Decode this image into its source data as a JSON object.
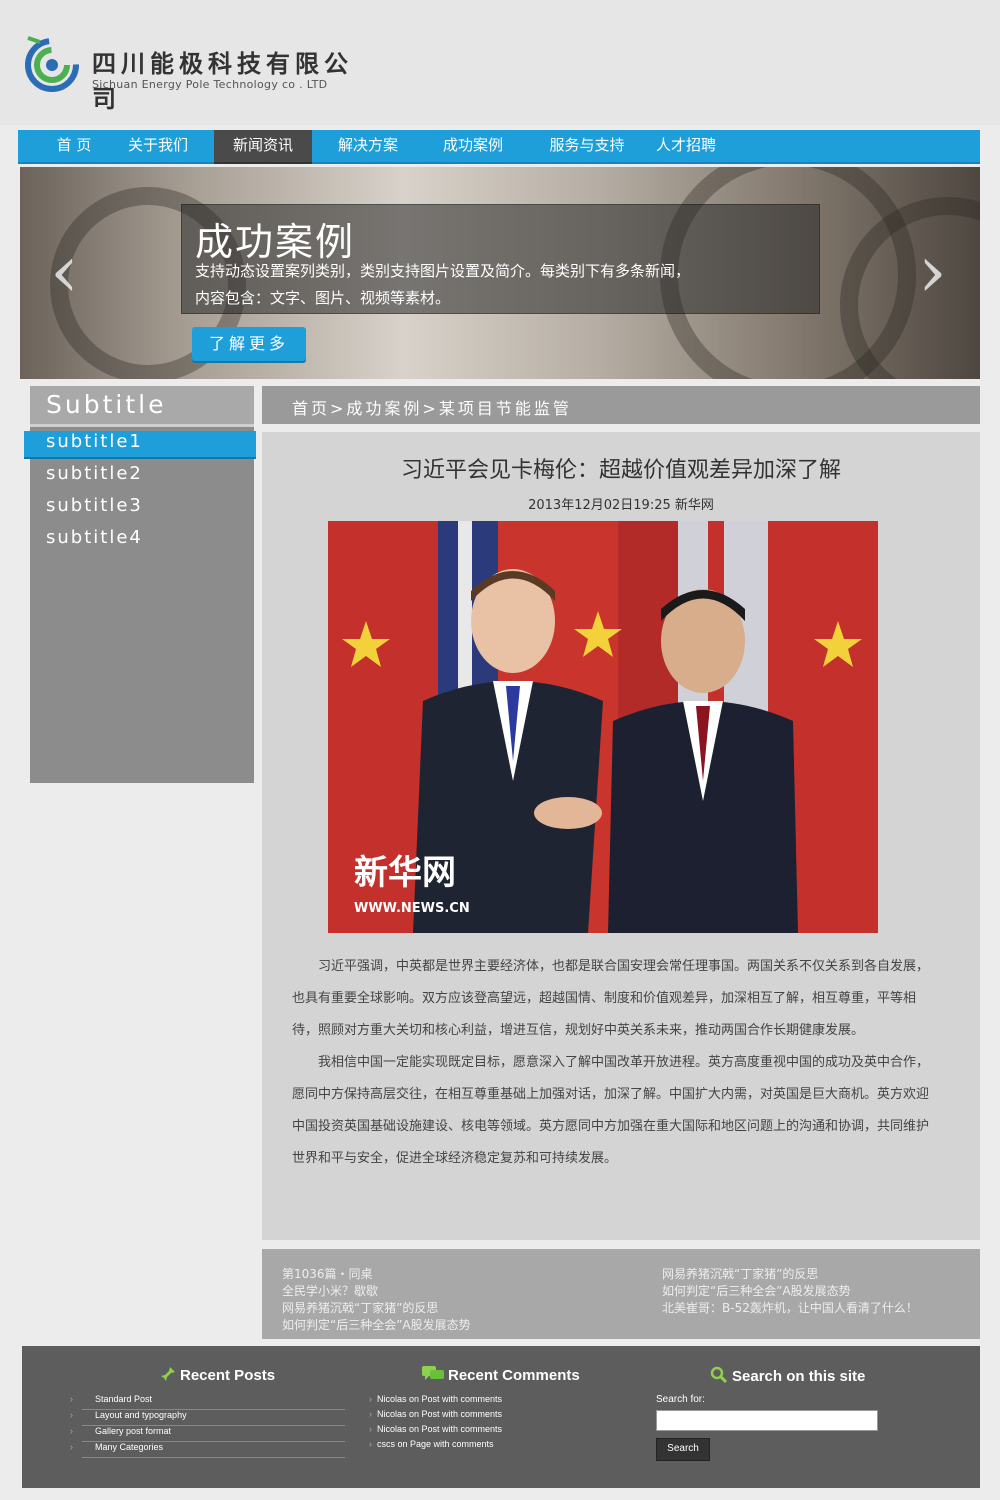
{
  "colors": {
    "accent": "#1e9fda",
    "nav_active": "#4a4a4a",
    "footer_bg": "#5d5d5d"
  },
  "header": {
    "company_cn": "四川能极科技有限公司",
    "company_en": "Sichuan Energy Pole Technology co . LTD"
  },
  "nav": {
    "items": [
      {
        "label": "首 页"
      },
      {
        "label": "关于我们"
      },
      {
        "label": "新闻资讯"
      },
      {
        "label": "解决方案"
      },
      {
        "label": "成功案例"
      },
      {
        "label": "服务与支持"
      },
      {
        "label": "人才招聘"
      }
    ],
    "active": "新闻资讯"
  },
  "banner": {
    "title": "成功案例",
    "desc_line1": "支持动态设置案列类别，类别支持图片设置及简介。每类别下有多条新闻，",
    "desc_line2": "内容包含：文字、图片、视频等素材。",
    "button": "了解更多",
    "prev_icon": "‹",
    "next_icon": "›"
  },
  "sidebar": {
    "title": "Subtitle",
    "items": [
      "subtitle1",
      "subtitle2",
      "subtitle3",
      "subtitle4"
    ],
    "active": "subtitle1"
  },
  "breadcrumb": "首页>成功案例>某项目节能监管",
  "article": {
    "title": "习近平会见卡梅伦：超越价值观差异加深了解",
    "meta": "2013年12月02日19:25  新华网",
    "photo_watermark_cn": "新华网",
    "photo_watermark_en": "WWW.NEWS.CN",
    "paragraphs": [
      "习近平强调，中英都是世界主要经济体，也都是联合国安理会常任理事国。两国关系不仅关系到各自发展，也具有重要全球影响。双方应该登高望远，超越国情、制度和价值观差异，加深相互了解，相互尊重，平等相待，照顾对方重大关切和核心利益，增进互信，规划好中英关系未来，推动两国合作长期健康发展。",
      "我相信中国一定能实现既定目标，愿意深入了解中国改革开放进程。英方高度重视中国的成功及英中合作，愿同中方保持高层交往，在相互尊重基础上加强对话，加深了解。中国扩大内需，对英国是巨大商机。英方欢迎中国投资英国基础设施建设、核电等领域。英方愿同中方加强在重大国际和地区问题上的沟通和协调，共同维护世界和平与安全，促进全球经济稳定复苏和可持续发展。"
    ]
  },
  "related_links": {
    "left": [
      "第1036篇・同桌",
      "全民学小米？歇歇",
      "网易养猪沉戟“丁家猪”的反思",
      "如何判定“后三种全会”A股发展态势"
    ],
    "right": [
      "网易养猪沉戟“丁家猪”的反思",
      "如何判定“后三种全会”A股发展态势",
      "北美崔哥：B-52轰炸机，让中国人看清了什么！"
    ]
  },
  "footer": {
    "recent_posts": {
      "title": "Recent Posts",
      "items": [
        "Standard Post",
        "Layout and typography",
        "Gallery post format",
        "Many Categories"
      ]
    },
    "recent_comments": {
      "title": "Recent Comments",
      "items": [
        "Nicolas on Post with comments",
        "Nicolas on Post with comments",
        "Nicolas on Post with comments",
        "cscs on Page with comments"
      ]
    },
    "search": {
      "title": "Search on this site",
      "label": "Search for:",
      "value": "",
      "button": "Search"
    }
  }
}
